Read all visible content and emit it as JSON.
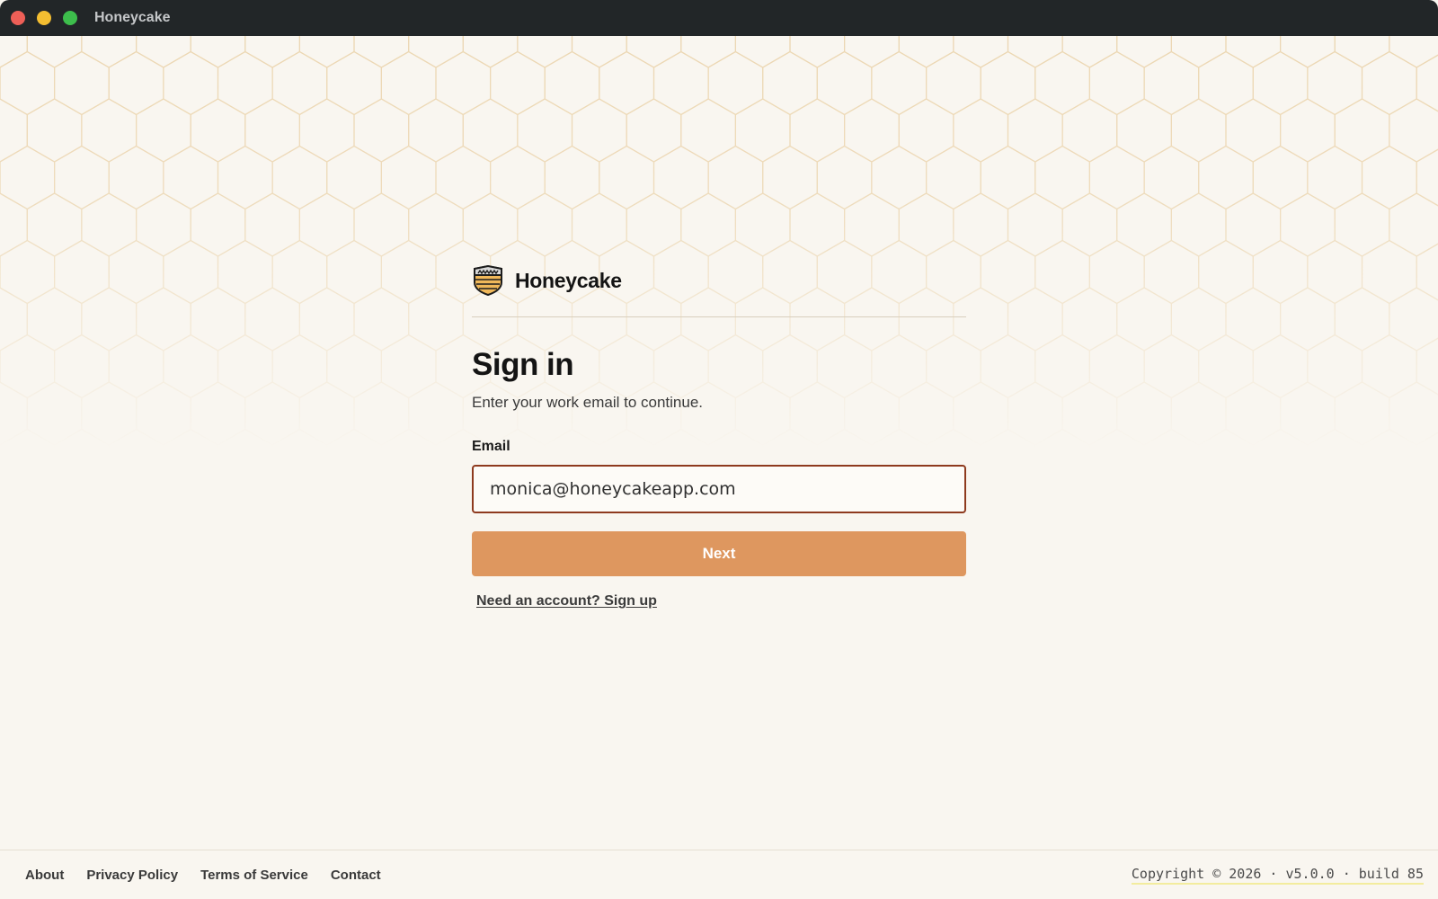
{
  "window": {
    "title": "Honeycake",
    "controls": [
      "close",
      "minimize",
      "maximize"
    ]
  },
  "brand": {
    "name": "Honeycake",
    "logo_icon": "honeycake-shield-logo"
  },
  "signin": {
    "heading": "Sign in",
    "subtitle": "Enter your work email to continue.",
    "email_label": "Email",
    "email_value": "monica@honeycakeapp.com",
    "next_label": "Next",
    "signup_link": "Need an account? Sign up"
  },
  "footer": {
    "links": [
      "About",
      "Privacy Policy",
      "Terms of Service",
      "Contact"
    ],
    "copyright": "Copyright © 2026 · v5.0.0 · build 85"
  },
  "colors": {
    "background": "#f9f6f0",
    "titlebar": "#222628",
    "accent": "#de975f",
    "input_border": "#8e3a1e",
    "honeycomb_line": "#ecd7b3"
  }
}
